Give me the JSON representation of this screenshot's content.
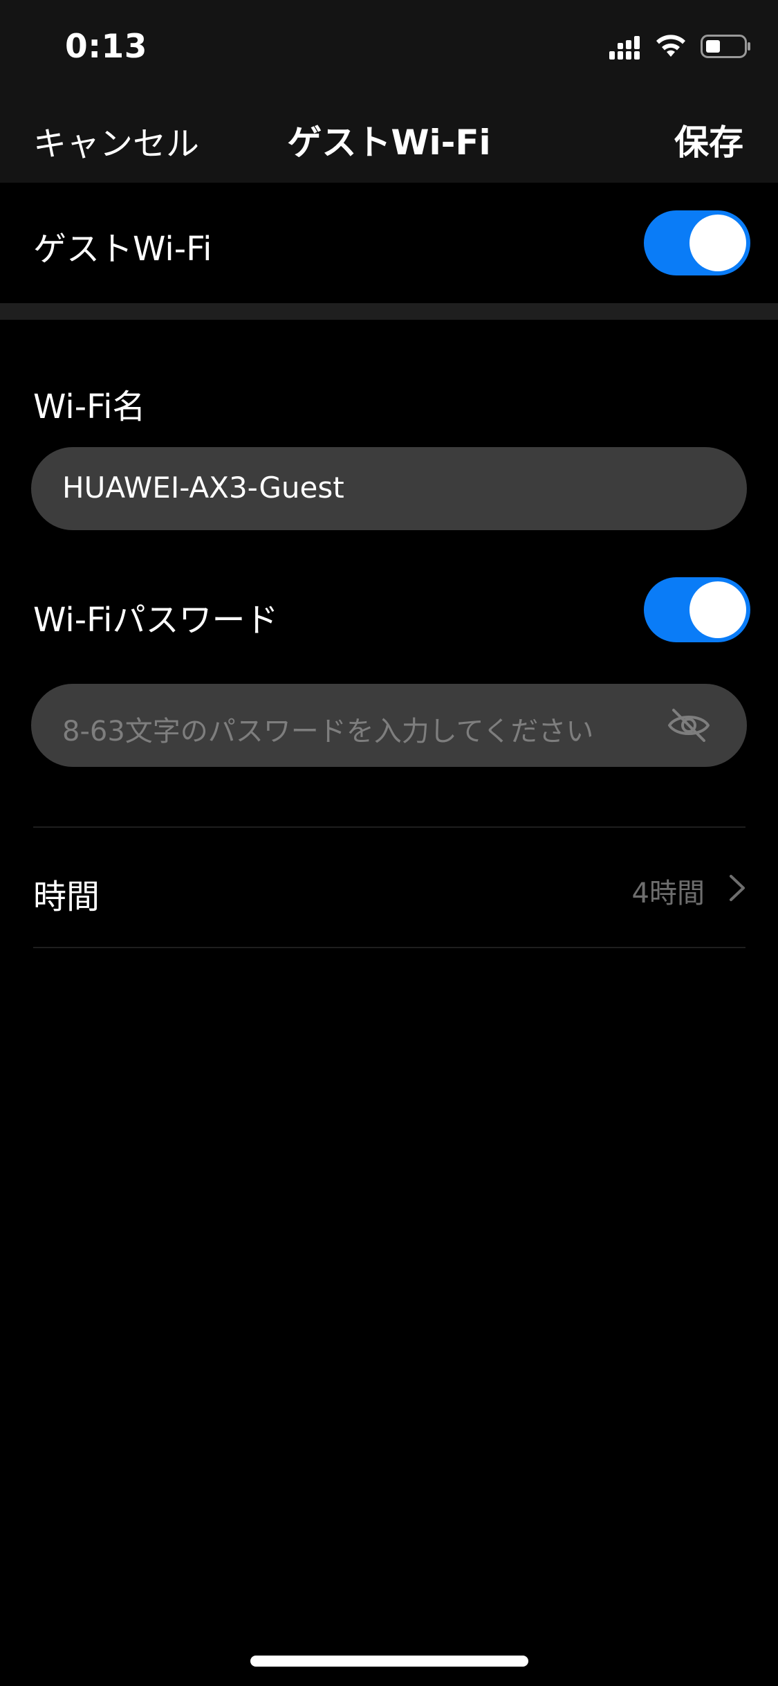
{
  "status_bar": {
    "time": "0:13"
  },
  "nav": {
    "cancel_label": "キャンセル",
    "title": "ゲストWi-Fi",
    "save_label": "保存"
  },
  "guest_wifi": {
    "label": "ゲストWi-Fi",
    "enabled": true
  },
  "wifi_name": {
    "label": "Wi-Fi名",
    "value": "HUAWEI-AX3-Guest"
  },
  "wifi_password": {
    "label": "Wi-Fiパスワード",
    "enabled": true,
    "placeholder": "8-63文字のパスワードを入力してください",
    "value": ""
  },
  "duration": {
    "label": "時間",
    "value": "4時間"
  },
  "colors": {
    "accent": "#0a7cf7",
    "background": "#000000",
    "bar": "#141414",
    "input": "#3d3d3d"
  },
  "icons": [
    "signal-icon",
    "wifi-icon",
    "battery-icon",
    "eye-off-icon",
    "chevron-right-icon"
  ]
}
